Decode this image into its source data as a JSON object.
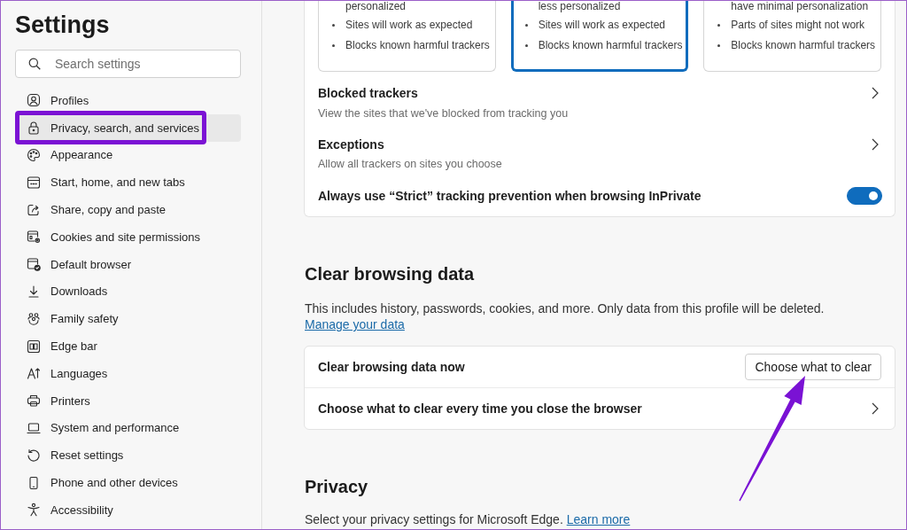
{
  "sidebar": {
    "title": "Settings",
    "search": {
      "placeholder": "Search settings"
    },
    "items": [
      {
        "label": "Profiles",
        "selected": false
      },
      {
        "label": "Privacy, search, and services",
        "selected": true
      },
      {
        "label": "Appearance",
        "selected": false
      },
      {
        "label": "Start, home, and new tabs",
        "selected": false
      },
      {
        "label": "Share, copy and paste",
        "selected": false
      },
      {
        "label": "Cookies and site permissions",
        "selected": false
      },
      {
        "label": "Default browser",
        "selected": false
      },
      {
        "label": "Downloads",
        "selected": false
      },
      {
        "label": "Family safety",
        "selected": false
      },
      {
        "label": "Edge bar",
        "selected": false
      },
      {
        "label": "Languages",
        "selected": false
      },
      {
        "label": "Printers",
        "selected": false
      },
      {
        "label": "System and performance",
        "selected": false
      },
      {
        "label": "Reset settings",
        "selected": false
      },
      {
        "label": "Phone and other devices",
        "selected": false
      },
      {
        "label": "Accessibility",
        "selected": false
      }
    ]
  },
  "tracking": {
    "cards": [
      {
        "selected": false,
        "top_line": "personalized",
        "points": [
          "Sites will work as expected",
          "Blocks known harmful trackers"
        ]
      },
      {
        "selected": true,
        "top_line": "less personalized",
        "points": [
          "Sites will work as expected",
          "Blocks known harmful trackers"
        ]
      },
      {
        "selected": false,
        "top_line": "have minimal personalization",
        "points": [
          "Parts of sites might not work",
          "Blocks known harmful trackers"
        ]
      }
    ],
    "rows": [
      {
        "kind": "link",
        "title": "Blocked trackers",
        "subtitle": "View the sites that we've blocked from tracking you"
      },
      {
        "kind": "link",
        "title": "Exceptions",
        "subtitle": "Allow all trackers on sites you choose"
      },
      {
        "kind": "toggle",
        "title": "Always use “Strict” tracking prevention when browsing InPrivate",
        "on": true
      }
    ]
  },
  "clear_browsing_data": {
    "heading": "Clear browsing data",
    "description": "This includes history, passwords, cookies, and more. Only data from this profile will be deleted.",
    "link": "Manage your data",
    "rows": [
      {
        "kind": "button",
        "title": "Clear browsing data now",
        "button": "Choose what to clear"
      },
      {
        "kind": "link",
        "title": "Choose what to clear every time you close the browser"
      }
    ]
  },
  "privacy": {
    "heading": "Privacy",
    "description": "Select your privacy settings for Microsoft Edge.",
    "link": "Learn more"
  }
}
